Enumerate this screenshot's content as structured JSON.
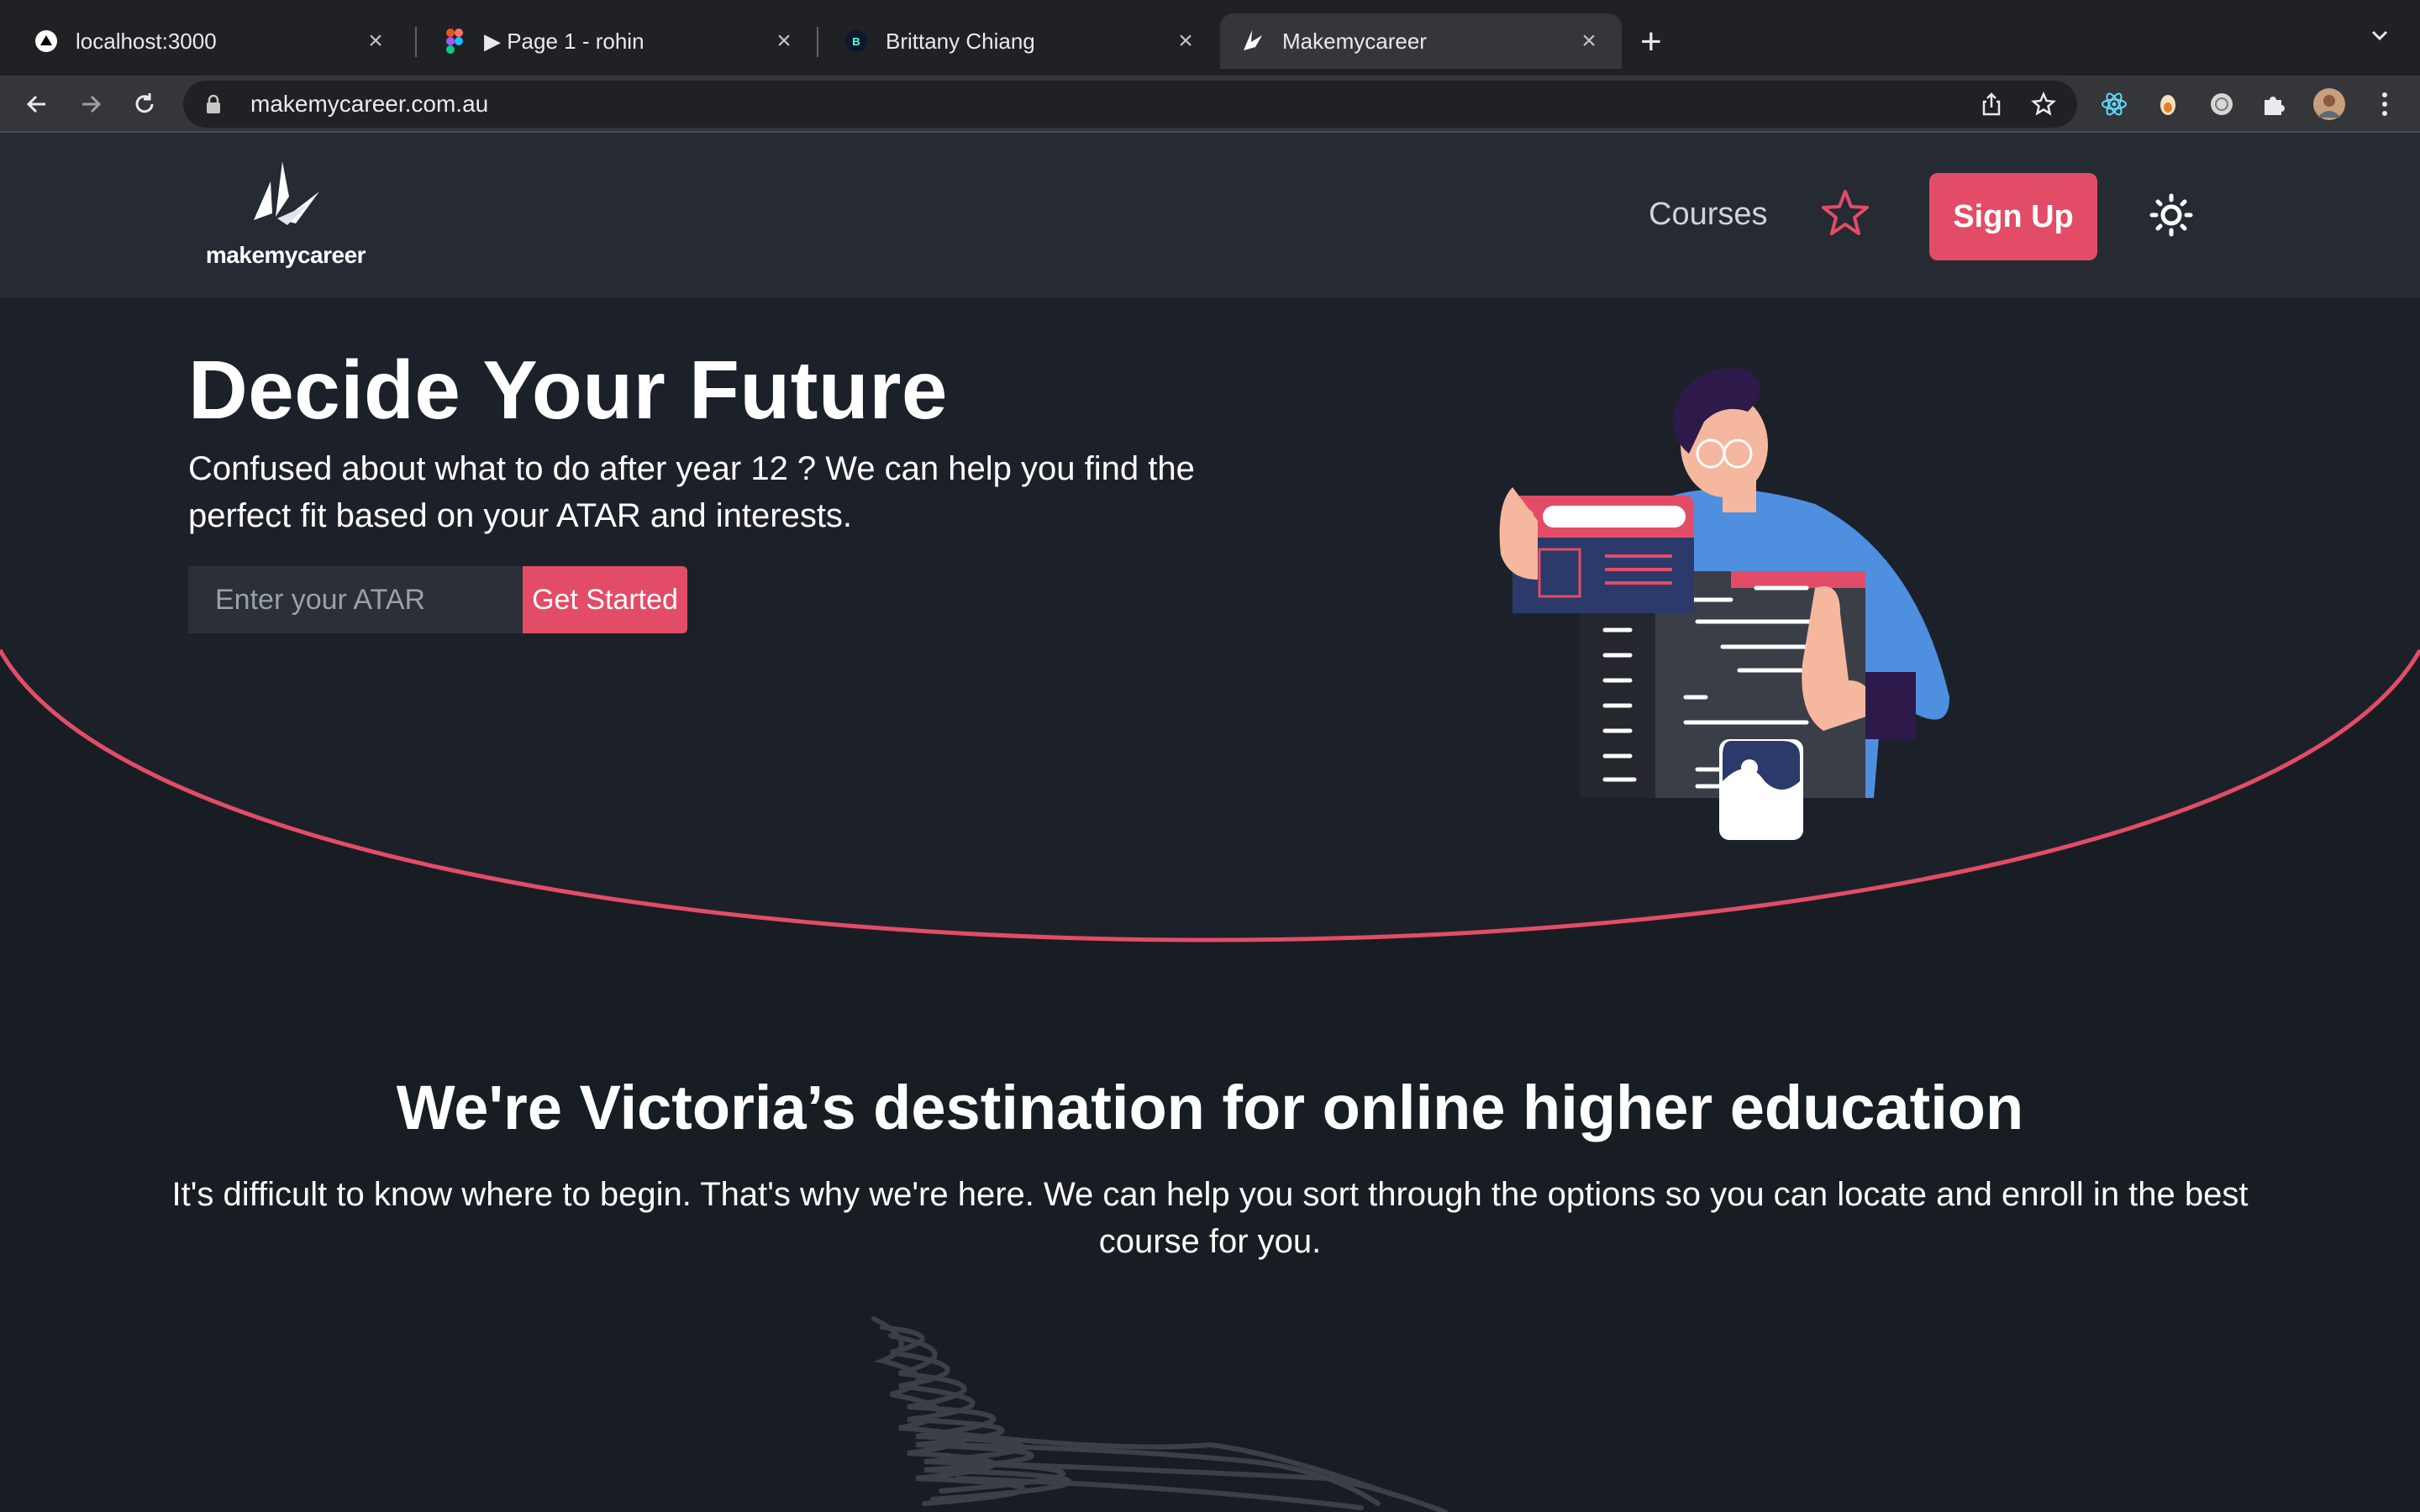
{
  "browser": {
    "tabs": [
      {
        "title": "localhost:3000",
        "icon": "vercel-triangle-icon"
      },
      {
        "title": "▶ Page 1 - rohin",
        "icon": "figma-icon"
      },
      {
        "title": "Brittany Chiang",
        "icon": "b-logo-icon"
      },
      {
        "title": "Makemycareer",
        "icon": "makemycareer-icon",
        "active": true
      }
    ],
    "url": "makemycareer.com.au"
  },
  "navbar": {
    "logo_text": "makemycareer",
    "courses_label": "Courses",
    "signup_label": "Sign Up"
  },
  "hero": {
    "title": "Decide Your Future",
    "subtitle": "Confused about what to do after year 12 ? We can help you find the perfect fit based on your ATAR and interests.",
    "atar_placeholder": "Enter your ATAR",
    "cta_label": "Get Started"
  },
  "section": {
    "title": "We're Victoria’s destination for online higher education",
    "subtitle": "It's difficult to know where to begin. That's why we're here. We can help you sort through the options so you can locate and enroll in the best course for you."
  },
  "colors": {
    "accent": "#e34c67",
    "page_bg": "#181d24",
    "navbar_bg": "#252a33"
  }
}
